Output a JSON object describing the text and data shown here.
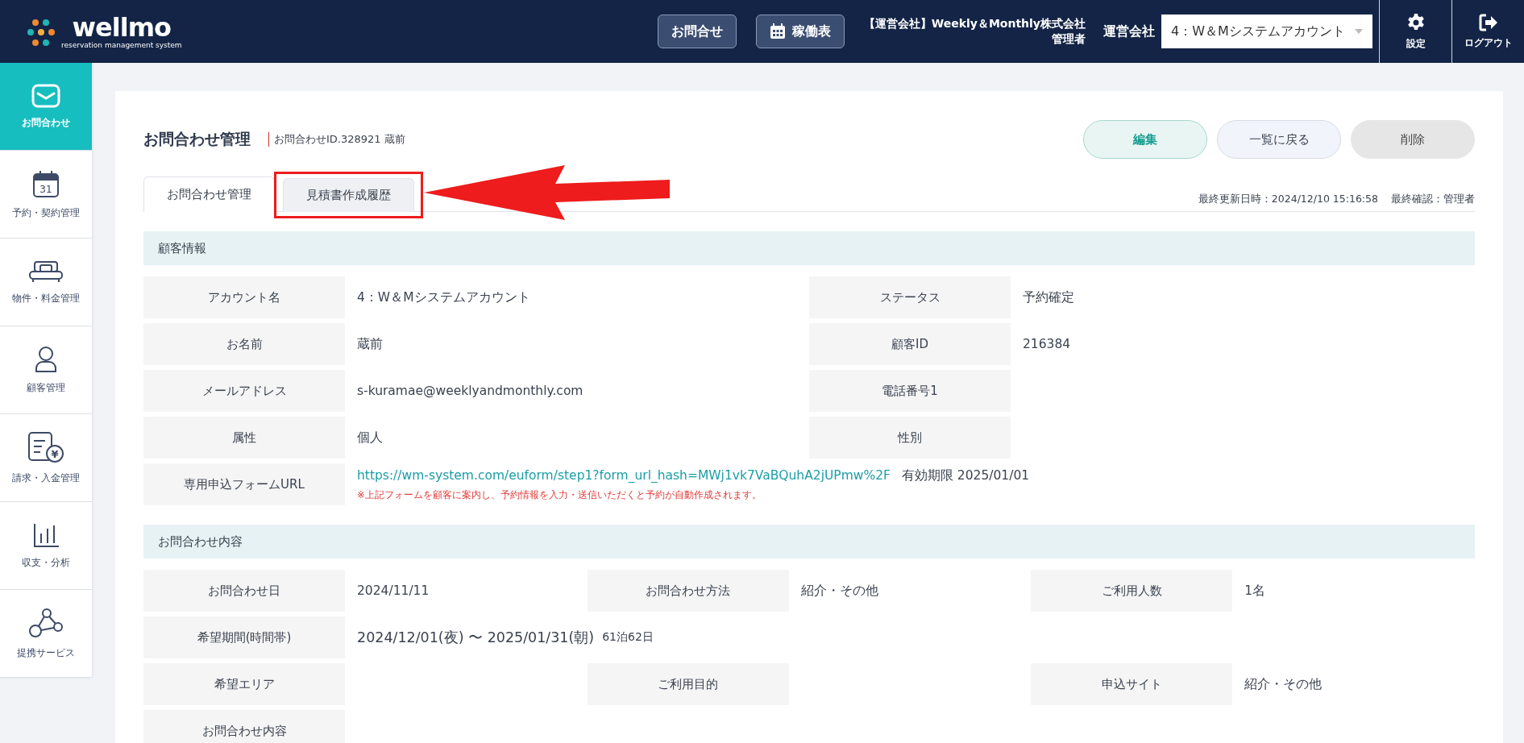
{
  "header": {
    "logo_text": "wellmo",
    "logo_tagline": "reservation management system",
    "buttons": [
      {
        "label": "お問合せ",
        "kind": "text"
      },
      {
        "label": "稼働表",
        "kind": "calendar"
      }
    ],
    "operator": {
      "company": "【運営会社】Weekly＆Monthly株式会社",
      "role": "管理者"
    },
    "company_select": {
      "label": "運営会社",
      "value": "4：W＆Mシステムアカウント"
    },
    "actions": [
      {
        "label": "設定",
        "kind": "gear"
      },
      {
        "label": "ログアウト",
        "kind": "logout"
      }
    ]
  },
  "sidebar": {
    "items": [
      {
        "label": "お問合わせ",
        "kind": "mail",
        "selected": true
      },
      {
        "label": "予約・契約管理",
        "kind": "calendar",
        "icon_text": "31",
        "selected": false
      },
      {
        "label": "物件・料金管理",
        "kind": "bed",
        "selected": false
      },
      {
        "label": "顧客管理",
        "kind": "person",
        "selected": false
      },
      {
        "label": "請求・入金管理",
        "kind": "invoice",
        "icon_text": "¥",
        "selected": false
      },
      {
        "label": "収支・分析",
        "kind": "chart",
        "selected": false
      },
      {
        "label": "提携サービス",
        "kind": "network",
        "selected": false
      }
    ]
  },
  "page": {
    "title": "お問合わせ管理",
    "subtitle": "お問合わせID.328921 蔵前",
    "buttons": [
      {
        "label": "編集",
        "kind": "primary"
      },
      {
        "label": "一覧に戻る",
        "kind": "secondary"
      },
      {
        "label": "削除",
        "kind": "danger"
      }
    ],
    "tabs": [
      {
        "label": "お問合わせ管理",
        "selected": true,
        "highlighted": false
      },
      {
        "label": "見積書作成履歴",
        "selected": false,
        "highlighted": true
      }
    ],
    "updated": "最終更新日時：2024/12/10 15:16:58",
    "confirmed": "最終確認：管理者"
  },
  "sections": [
    {
      "title": "顧客情報",
      "kind": "two-column",
      "rows": [
        {
          "fields": [
            {
              "label": "アカウント名",
              "value": "4：W＆Mシステムアカウント"
            },
            {
              "label": "ステータス",
              "value": "予約確定"
            }
          ]
        },
        {
          "fields": [
            {
              "label": "お名前",
              "value": "蔵前"
            },
            {
              "label": "顧客ID",
              "value": "216384"
            }
          ]
        },
        {
          "fields": [
            {
              "label": "メールアドレス",
              "value": "s-kuramae@weeklyandmonthly.com"
            },
            {
              "label": "電話番号1"
            }
          ]
        },
        {
          "fields": [
            {
              "label": "属性",
              "value": "個人"
            },
            {
              "label": "性別"
            }
          ]
        },
        {
          "fields": [
            {
              "label": "専用申込フォームURL",
              "kind": "link",
              "value": "https://wm-system.com/euform/step1?form_url_hash=MWj1vk7VaBQuhA2jUPmw%2F",
              "suffix": "有効期限 2025/01/01",
              "note": "※上記フォームを顧客に案内し、予約情報を入力・送信いただくと予約が自動作成されます。"
            }
          ]
        }
      ]
    },
    {
      "title": "お問合わせ内容",
      "kind": "three-column",
      "rows": [
        {
          "fields": [
            {
              "label": "お問合わせ日",
              "value": "2024/11/11"
            },
            {
              "label": "お問合わせ方法",
              "value": "紹介・その他"
            },
            {
              "label": "ご利用人数",
              "value": "1名"
            }
          ]
        },
        {
          "fields": [
            {
              "label": "希望期間(時間帯)",
              "kind": "period",
              "value": "2024/12/01(夜) 〜 2025/01/31(朝)",
              "suffix": "61泊62日"
            }
          ]
        },
        {
          "fields": [
            {
              "label": "希望エリア"
            },
            {
              "label": "ご利用目的"
            },
            {
              "label": "申込サイト",
              "value": "紹介・その他"
            }
          ]
        },
        {
          "fields": [
            {
              "label": "お問合わせ内容"
            }
          ]
        }
      ]
    }
  ]
}
